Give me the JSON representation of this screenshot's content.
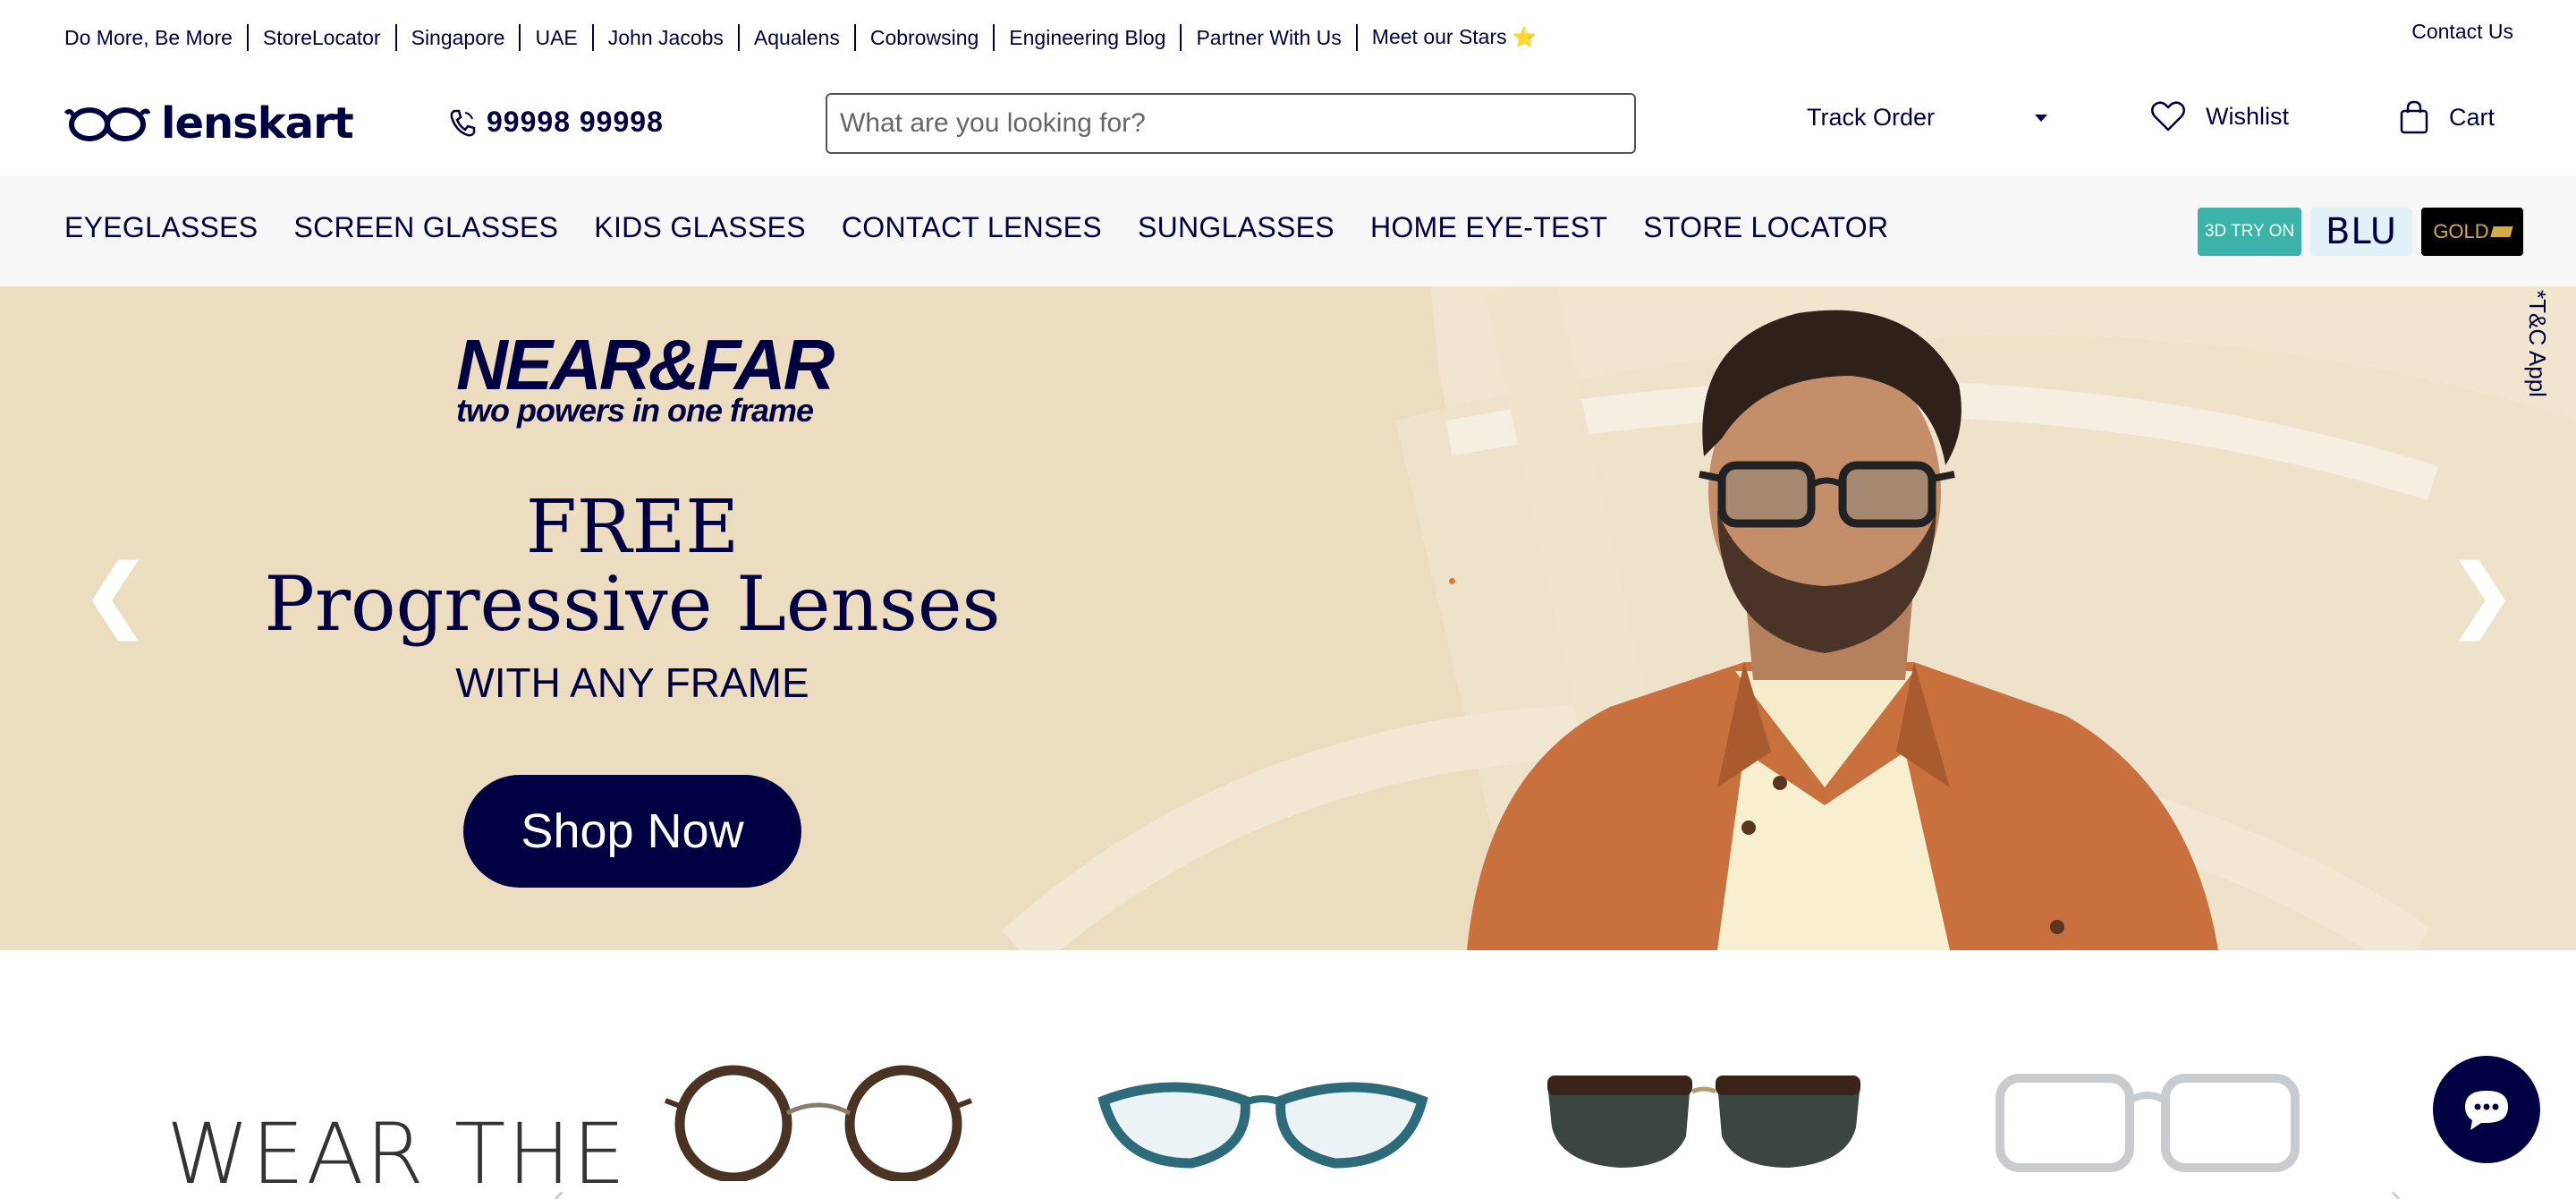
{
  "top_links": [
    "Do More, Be More",
    "StoreLocator",
    "Singapore",
    "UAE",
    "John Jacobs",
    "Aqualens",
    "Cobrowsing",
    "Engineering Blog",
    "Partner With Us",
    "Meet our Stars"
  ],
  "contact_us": "Contact Us",
  "logo_text": "lenskart",
  "phone": "99998 99998",
  "search": {
    "placeholder": "What are you looking for?"
  },
  "header": {
    "track_order": "Track Order",
    "wishlist": "Wishlist",
    "cart": "Cart"
  },
  "nav": [
    "EYEGLASSES",
    "SCREEN GLASSES",
    "KIDS GLASSES",
    "CONTACT LENSES",
    "SUNGLASSES",
    "HOME EYE-TEST",
    "STORE LOCATOR"
  ],
  "badges": {
    "try_on": "3D TRY ON",
    "blu": "BLU",
    "gold": "GOLD"
  },
  "hero": {
    "brand_line1": "NEAR&FAR",
    "brand_line2": "two powers in one frame",
    "headline1": "FREE",
    "headline2": "Progressive Lenses",
    "subhead": "WITH ANY FRAME",
    "cta": "Shop Now",
    "terms": "*T&C Appl"
  },
  "section": {
    "title": "WEAR THE"
  },
  "colors": {
    "navy": "#000042",
    "banner": "#ecdcc0",
    "teal": "#3bb3a9"
  },
  "icons": [
    "phone-icon",
    "heart-icon",
    "bag-icon",
    "chevron-left-icon",
    "chevron-right-icon",
    "chat-icon",
    "star-icon"
  ]
}
